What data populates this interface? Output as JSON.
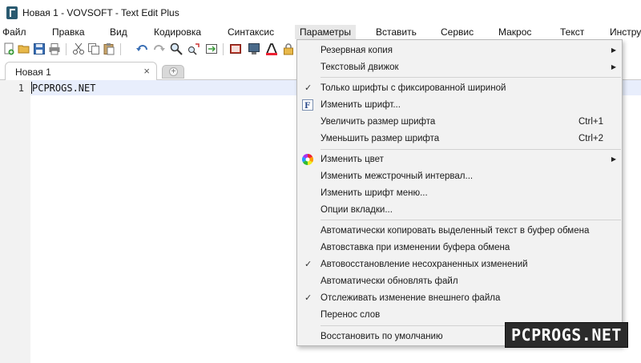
{
  "window": {
    "title": "Новая 1 - VOVSOFT - Text Edit Plus"
  },
  "menubar": {
    "items": [
      "Файл",
      "Правка",
      "Вид",
      "Кодировка",
      "Синтаксис",
      "Параметры",
      "Вставить",
      "Сервис",
      "Макрос",
      "Текст",
      "Инстру"
    ],
    "active_index": 5
  },
  "toolbar": {
    "buttons": [
      "new-file-icon",
      "open-folder-icon",
      "save-icon",
      "print-icon",
      "cut-icon",
      "copy-icon",
      "paste-icon",
      "undo-icon",
      "redo-icon",
      "find-icon",
      "replace-icon",
      "goto-icon",
      "book-icon",
      "monitor-icon",
      "text-color-icon",
      "lock-icon"
    ]
  },
  "tabs": {
    "items": [
      {
        "label": "Новая 1",
        "close": "×"
      }
    ],
    "new_tab": "+"
  },
  "editor": {
    "line_number": "1",
    "line_text": "PCPROGS.NET"
  },
  "dropdown": {
    "items": [
      {
        "label": "Резервная копия",
        "submenu": true
      },
      {
        "label": "Текстовый движок",
        "submenu": true
      },
      {
        "label": "Только шрифты с фиксированной шириной",
        "checked": true
      },
      {
        "label": "Изменить шрифт...",
        "icon": "font-icon"
      },
      {
        "label": "Увеличить размер шрифта",
        "shortcut": "Ctrl+1"
      },
      {
        "label": "Уменьшить размер шрифта",
        "shortcut": "Ctrl+2"
      },
      {
        "label": "Изменить цвет",
        "submenu": true,
        "icon": "color-wheel-icon"
      },
      {
        "label": "Изменить межстрочный интервал..."
      },
      {
        "label": "Изменить шрифт меню..."
      },
      {
        "label": "Опции вкладки..."
      },
      {
        "label": "Автоматически копировать выделенный текст в буфер обмена"
      },
      {
        "label": "Автовставка при изменении буфера обмена"
      },
      {
        "label": "Автовосстановление несохраненных изменений",
        "checked": true
      },
      {
        "label": "Автоматически обновлять файл"
      },
      {
        "label": "Отслеживать изменение внешнего файла",
        "checked": true
      },
      {
        "label": "Перенос слов"
      },
      {
        "label": "Восстановить по умолчанию"
      }
    ],
    "check_glyph": "✓",
    "arrow_glyph": "▶"
  },
  "watermark": {
    "text": "PCPROGS.NET"
  },
  "colors": {
    "menu_bg": "#f2f2f2",
    "active_line": "#e8eefc",
    "gutter": "#f2f2f2",
    "accent": "#2a5a70"
  }
}
